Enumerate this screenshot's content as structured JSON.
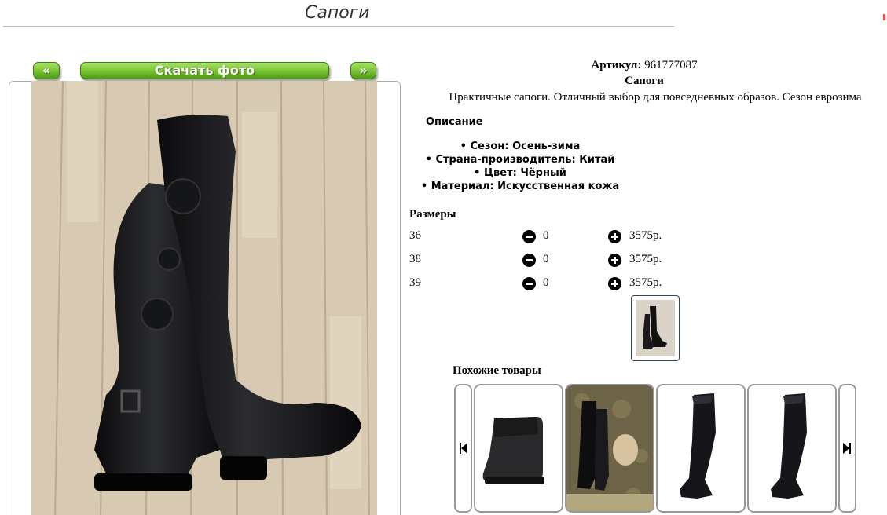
{
  "page": {
    "title": "Сапоги"
  },
  "gallery": {
    "prev_label": "«",
    "download_label": "Скачать фото",
    "next_label": "»"
  },
  "product": {
    "article_label": "Артикул:",
    "article_value": "961777087",
    "name": "Сапоги",
    "short_description": "Практичные сапоги. Отличный выбор для повседневных образов. Сезон еврозима",
    "description_heading": "Описание",
    "features": [
      "Сезон: Осень-зима",
      "Страна-производитель: Китай",
      "Цвет: Чёрный",
      "Материал: Искусственная кожа"
    ]
  },
  "sizes": {
    "heading": "Размеры",
    "rows": [
      {
        "size": "36",
        "qty": "0",
        "price": "3575р."
      },
      {
        "size": "38",
        "qty": "0",
        "price": "3575р."
      },
      {
        "size": "39",
        "qty": "0",
        "price": "3575р."
      }
    ]
  },
  "similar": {
    "heading": "Похожие товары",
    "items": [
      {
        "name": "ankle-felt-boot"
      },
      {
        "name": "knee-boot-with-fur-toy"
      },
      {
        "name": "over-knee-boot"
      },
      {
        "name": "over-knee-boot-2"
      }
    ]
  },
  "colors": {
    "button_green": "#7ac534",
    "border": "#999999"
  }
}
